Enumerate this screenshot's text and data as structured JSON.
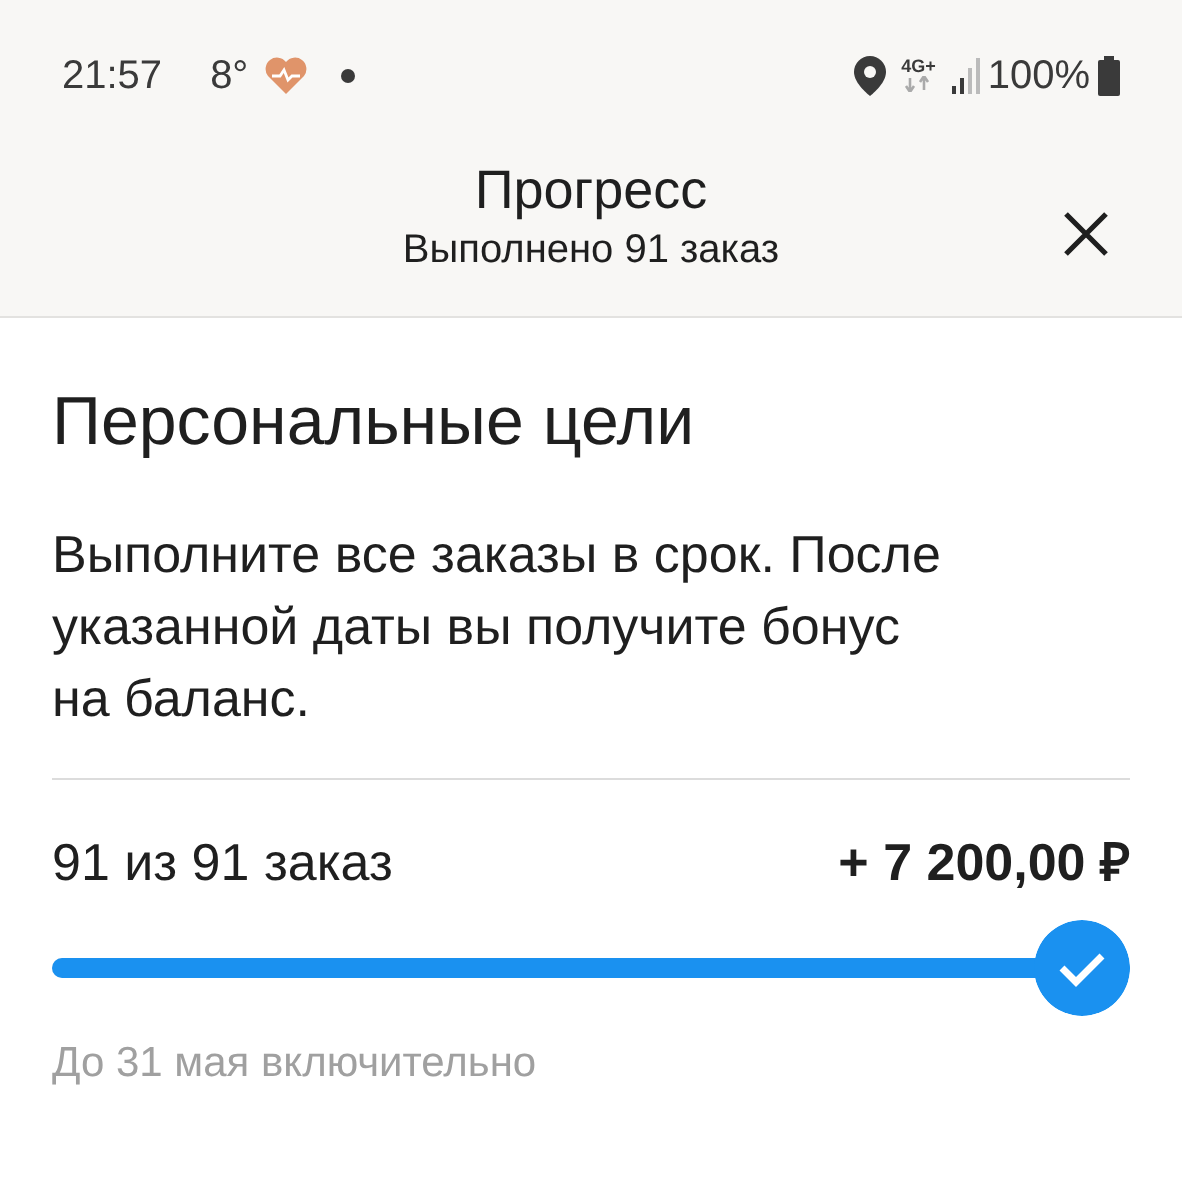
{
  "status_bar": {
    "time": "21:57",
    "temperature": "8°",
    "network": "4G+",
    "battery": "100%"
  },
  "header": {
    "title": "Прогресс",
    "subtitle": "Выполнено 91 заказ"
  },
  "goal": {
    "title": "Персональные цели",
    "description": "Выполните все заказы в срок. После указанной даты вы получите бонус на баланс.",
    "count": "91 из 91 заказ",
    "bonus": "+ 7 200,00 ₽",
    "level": 1,
    "completed": true,
    "deadline": "До 31 мая включительно"
  }
}
